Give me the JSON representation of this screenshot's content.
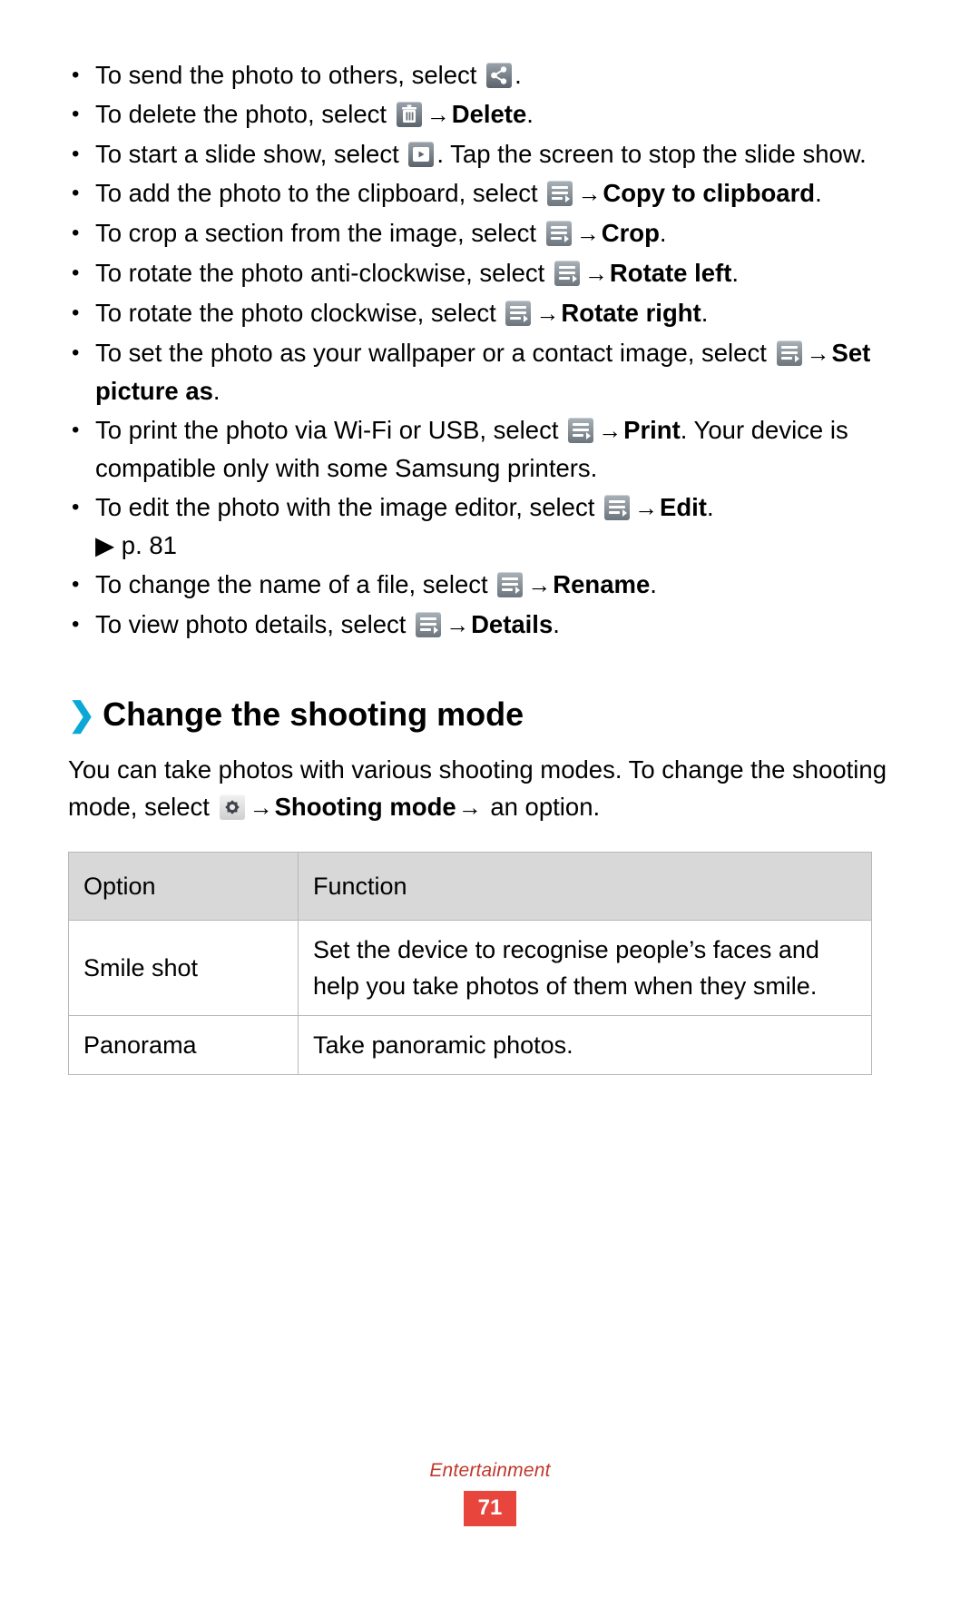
{
  "bullets": [
    {
      "id": "send-photo",
      "pre": "To send the photo to others, select ",
      "icon": "share-icon",
      "post": "."
    },
    {
      "id": "delete-photo",
      "pre": "To delete the photo, select ",
      "icon": "trash-icon",
      "arrow": "→",
      "bold": "Delete",
      "post": "."
    },
    {
      "id": "slide-show",
      "pre": "To start a slide show, select ",
      "icon": "play-icon",
      "post": ". Tap the screen to stop the slide show."
    },
    {
      "id": "copy-to-clipboard",
      "pre": "To add the photo to the clipboard, select ",
      "icon": "menu-icon",
      "arrow": "→",
      "bold": "Copy to clipboard",
      "post": "."
    },
    {
      "id": "crop",
      "pre": "To crop a section from the image, select ",
      "icon": "menu-icon",
      "arrow": "→",
      "bold": "Crop",
      "post": "."
    },
    {
      "id": "rotate-left",
      "pre": "To rotate the photo anti-clockwise, select ",
      "icon": "menu-icon",
      "arrow": "→",
      "bold": "Rotate left",
      "post": "."
    },
    {
      "id": "rotate-right",
      "pre": "To rotate the photo clockwise, select ",
      "icon": "menu-icon",
      "arrow": "→",
      "bold": "Rotate right",
      "post": "."
    },
    {
      "id": "set-picture-as",
      "pre": "To set the photo as your wallpaper or a contact image, select ",
      "icon": "menu-icon",
      "arrow": "→",
      "bold": "Set picture as",
      "post": "."
    },
    {
      "id": "print",
      "pre": "To print the photo via Wi-Fi or USB, select ",
      "icon": "menu-icon",
      "arrow": "→",
      "bold": "Print",
      "post": ". Your device is compatible only with some Samsung printers."
    },
    {
      "id": "edit",
      "pre": "To edit the photo with the image editor, select ",
      "icon": "menu-icon",
      "arrow": "→",
      "bold": "Edit",
      "post": ".",
      "ref": "▶ p. 81"
    },
    {
      "id": "rename",
      "pre": "To change the name of a file, select ",
      "icon": "menu-icon",
      "arrow": "→",
      "bold": "Rename",
      "post": "."
    },
    {
      "id": "details",
      "pre": "To view photo details, select ",
      "icon": "menu-icon",
      "arrow": "→",
      "bold": "Details",
      "post": "."
    }
  ],
  "section": {
    "chevron": "❯",
    "heading": "Change the shooting mode",
    "intro_pre": "You can take photos with various shooting modes. To change the shooting mode, select ",
    "intro_icon": "settings-icon",
    "intro_arrow": "→",
    "intro_bold": "Shooting mode",
    "intro_arrow2": "→",
    "intro_post": " an option."
  },
  "table": {
    "headers": [
      "Option",
      "Function"
    ],
    "rows": [
      {
        "option": "Smile shot",
        "function": "Set the device to recognise people’s faces and help you take photos of them when they smile."
      },
      {
        "option": "Panorama",
        "function": "Take panoramic photos."
      }
    ]
  },
  "footer": {
    "section_label": "Entertainment",
    "page_number": "71"
  },
  "colors": {
    "accent": "#0aa8d6",
    "footer_red": "#e8463c",
    "table_header_bg": "#d8d8d8"
  }
}
